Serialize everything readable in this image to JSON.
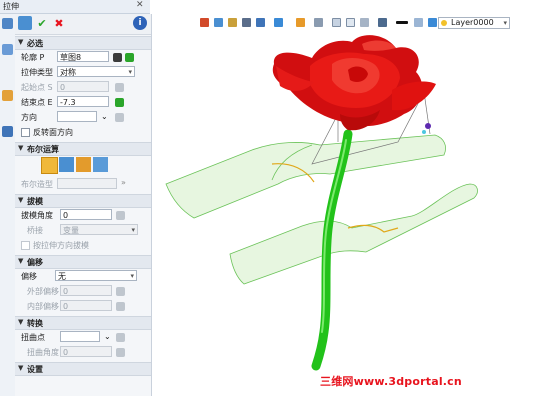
{
  "window": {
    "title": "拉伸",
    "close_glyph": "✕"
  },
  "toolbar": {
    "ok_glyph": "✔",
    "cancel_glyph": "✖",
    "info_glyph": "i"
  },
  "sections": {
    "required": "必选",
    "boolean": "布尔运算",
    "draft": "拔模",
    "offset": "偏移",
    "twist": "转换",
    "settings": "设置"
  },
  "required": {
    "profile_label": "轮廓 P",
    "profile_value": "草图8",
    "extrude_type_label": "拉伸类型",
    "extrude_type_value": "对称",
    "start_label": "起始点 S",
    "start_value": "0",
    "end_label": "结束点 E",
    "end_value": "-7.3",
    "direction_label": "方向",
    "direction_value": "",
    "reverse_label": "反转面方向"
  },
  "boolean": {
    "type_label": "布尔造型",
    "type_value": ""
  },
  "draft": {
    "angle_label": "拔模角度",
    "angle_value": "0",
    "edge_label": "桥接",
    "edge_value": "变量",
    "checkbox_label": "按拉伸方向拔模"
  },
  "offset": {
    "offset_label": "偏移",
    "offset_value": "无",
    "outer_label": "外部偏移",
    "outer_value": "0",
    "inner_label": "内部偏移",
    "inner_value": "0"
  },
  "twist": {
    "point_label": "扭曲点",
    "point_value": "",
    "angle_label": "扭曲角度",
    "angle_value": "0"
  },
  "viewport": {
    "layer": "Layer0000"
  },
  "watermark": "三维网www.3dportal.cn",
  "colors": {
    "petal": "#e51212",
    "stem": "#22c21a",
    "surface": "#b9e6a6",
    "accent_red": "#e8141e",
    "ok_green": "#2aa52a"
  }
}
